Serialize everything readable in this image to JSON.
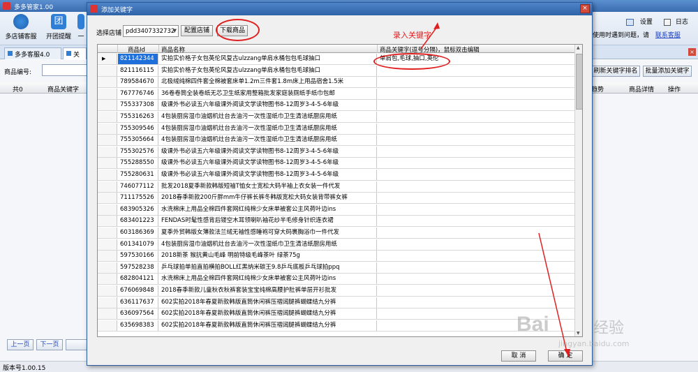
{
  "app": {
    "title": "多多管家1.00",
    "toolbar": [
      "多店铺客服",
      "开团提醒",
      "一"
    ],
    "right_toolbar": [
      "设置",
      "日志"
    ],
    "help_text": "使用时遇到问题，请",
    "help_link": "联系客服",
    "tabs": [
      "多多客服4.0",
      "关"
    ],
    "product_no_label": "商品编号:",
    "left_headers": [
      "共0",
      "商品关键字"
    ],
    "refresh_btn": "刷新关键字排名",
    "batch_add_btn": "批量添加关键字",
    "right_headers": [
      "趋势",
      "商品详情",
      "操作"
    ],
    "prev_page": "上一页",
    "next_page": "下一页",
    "version": "版本号1.00.15"
  },
  "dialog": {
    "title": "添加关键字",
    "store_label": "选择店铺",
    "store_value": "pdd3407332732",
    "config_btn": "配置店铺",
    "download_btn": "下载商品",
    "annotation": "录入关键字",
    "headers": [
      "商品Id",
      "商品名称",
      "商品关键字(逗号分隔)，鼠标双击编辑"
    ],
    "cancel_btn": "取 消",
    "ok_btn": "确 定",
    "rows": [
      {
        "id": "821142344",
        "name": "实拍实价格子女包英伦风复古ulzzang单肩水桶包包毛球抽口",
        "kw": "单肩包,毛球,抽口,英伦"
      },
      {
        "id": "821116115",
        "name": "实拍实价格子女包英伦风复古ulzzang单肩水桶包包毛球抽口",
        "kw": ""
      },
      {
        "id": "789584670",
        "name": "北极绒纯棉四件套全棉被套床单1.2m三件套1.8m床上用品宿舍1.5米",
        "kw": ""
      },
      {
        "id": "767776746",
        "name": "36卷卷筒全装卷纸无芯卫生纸家用整箱批发家庭装厕纸手纸巾包邮",
        "kw": ""
      },
      {
        "id": "755337308",
        "name": "级课外书必读五六年级课外阅读文学读物图书8-12周岁3-4-5-6年级",
        "kw": ""
      },
      {
        "id": "755316263",
        "name": "4包装厨房湿巾油烟机灶台去油污一次性湿纸巾卫生清洁纸厨房用纸",
        "kw": ""
      },
      {
        "id": "755309546",
        "name": "4包装厨房湿巾油烟机灶台去油污一次性湿纸巾卫生清洁纸厨房用纸",
        "kw": ""
      },
      {
        "id": "755305664",
        "name": "4包装厨房湿巾油烟机灶台去油污一次性湿纸巾卫生清洁纸厨房用纸",
        "kw": ""
      },
      {
        "id": "755302576",
        "name": "级课外书必读五六年级课外阅读文学读物图书8-12周岁3-4-5-6年级",
        "kw": ""
      },
      {
        "id": "755288550",
        "name": "级课外书必读五六年级课外阅读文学读物图书8-12周岁3-4-5-6年级",
        "kw": ""
      },
      {
        "id": "755280631",
        "name": "级课外书必读五六年级课外阅读文学读物图书8-12周岁3-4-5-6年级",
        "kw": ""
      },
      {
        "id": "746077112",
        "name": "批发2018夏季新款韩版短袖T恤女士宽松大码半袖上衣女装一件代发",
        "kw": ""
      },
      {
        "id": "711175526",
        "name": "2018春季新款200斤胖mm牛仔裤长裤冬韩版宽松大码女装背带裤女裤",
        "kw": ""
      },
      {
        "id": "683905326",
        "name": "水洗棉床上用品全棉四件套网红纯棉少女床单被套公主风荷叶边ins",
        "kw": ""
      },
      {
        "id": "683401223",
        "name": "FENDAS时髦性感背后镂空木耳领喇叭袖花纱半毛修身针织连衣裙",
        "kw": ""
      },
      {
        "id": "603186369",
        "name": "夏季外贸韩版女薄款法兰绒无袖性感睡袍可穿大码裹胸浴巾一件代发",
        "kw": ""
      },
      {
        "id": "601341079",
        "name": "4包装厨房湿巾油烟机灶台去油污一次性湿纸巾卫生清洁纸厨房用纸",
        "kw": ""
      },
      {
        "id": "597530166",
        "name": "2018新茶 猴抗黄山毛峰 明前特级毛峰茶叶 绿茶75g",
        "kw": ""
      },
      {
        "id": "597528238",
        "name": "乒乓球拍单拍直拍横拍BOLL红黑纳米碳王9.8乒乓底板乒乓球拍ppq",
        "kw": ""
      },
      {
        "id": "682804121",
        "name": "水洗棉床上用品全棉四件套网红纯棉少女床单被套公主风荷叶边ins",
        "kw": ""
      },
      {
        "id": "676069848",
        "name": "2018春季新款儿童秋衣秋裤套装宝宝纯棉高腰护肚裤单层开衫批发",
        "kw": ""
      },
      {
        "id": "636117637",
        "name": "602实拍2018年春夏新款韩版直筒休闲裤压褶阔腿裤蝴蝶结九分裤",
        "kw": ""
      },
      {
        "id": "636097564",
        "name": "602实拍2018年春夏新款韩版直筒休闲裤压褶阔腿裤蝴蝶结九分裤",
        "kw": ""
      },
      {
        "id": "635698383",
        "name": "602实拍2018年春夏新款韩版直筒休闲裤压褶阔腿裤蝴蝶结九分裤",
        "kw": ""
      }
    ]
  },
  "watermark": {
    "brand": "Bai",
    "brand2": "经验",
    "url": "jingyan.baidu.com"
  }
}
